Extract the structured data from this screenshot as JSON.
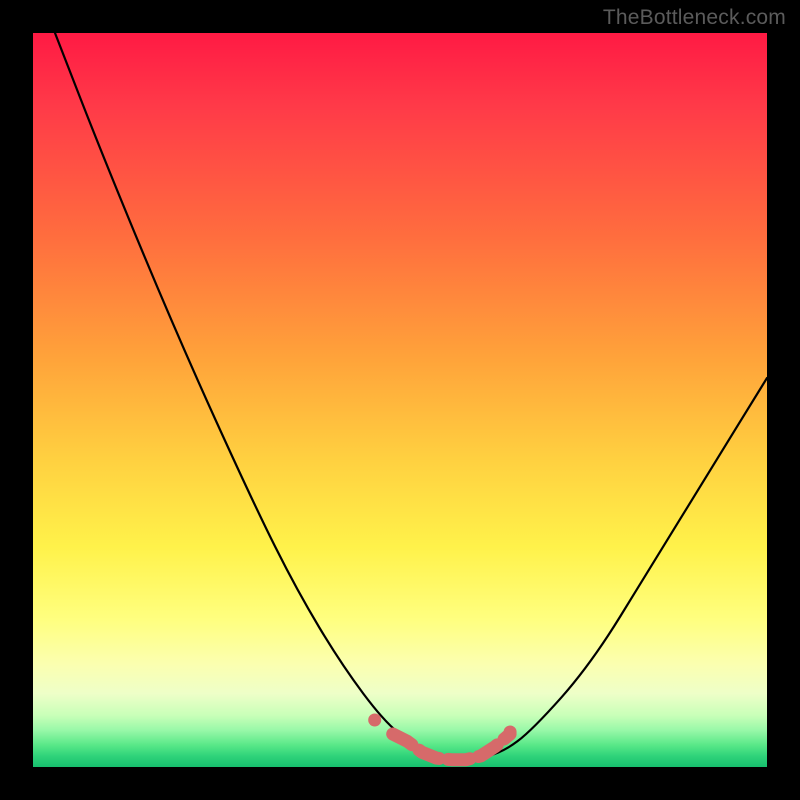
{
  "watermark": "TheBottleneck.com",
  "colors": {
    "background": "#000000",
    "gradient_top": "#ff1a44",
    "gradient_bottom": "#17c06e",
    "curve": "#000000",
    "marker": "#d66a6a"
  },
  "chart_data": {
    "type": "line",
    "title": "",
    "xlabel": "",
    "ylabel": "",
    "xlim": [
      0,
      100
    ],
    "ylim": [
      0,
      100
    ],
    "series": [
      {
        "name": "bottleneck-curve",
        "x": [
          3,
          10,
          20,
          30,
          36,
          42,
          48,
          52,
          56,
          60,
          64,
          68,
          76,
          84,
          92,
          100
        ],
        "y": [
          100,
          82,
          58,
          36,
          24,
          14,
          6,
          3,
          1,
          1,
          2,
          5,
          14,
          27,
          40,
          53
        ]
      }
    ],
    "markers": {
      "name": "highlight-band",
      "x": [
        49,
        51,
        53,
        55,
        57,
        59,
        61,
        63,
        65
      ],
      "y": [
        4.5,
        3.5,
        2.0,
        1.2,
        1.0,
        1.0,
        1.5,
        2.8,
        4.5
      ]
    },
    "grid": false,
    "legend": false
  }
}
